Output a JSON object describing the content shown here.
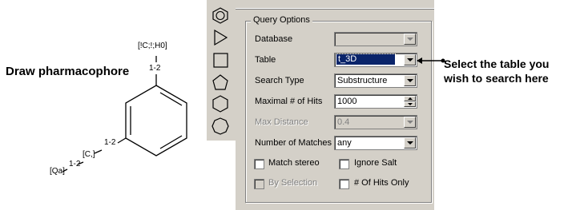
{
  "molecule": {
    "title": "Draw pharmacophore",
    "top_feature": "[!C;!;H0]",
    "top_range": "1-2",
    "mid_range": "1-2",
    "mid_atom": "[C,]",
    "bottom_range": "1-2",
    "bottom_feature": "[Qa]"
  },
  "tools": [
    "benzene-tool-icon",
    "triangle-tool-icon",
    "square-tool-icon",
    "pentagon-tool-icon",
    "hexagon-tool-icon",
    "heptagon-tool-icon"
  ],
  "query_options": {
    "legend": "Query Options",
    "database": {
      "label": "Database",
      "value": ""
    },
    "table": {
      "label": "Table",
      "value": "t_3D"
    },
    "search_type": {
      "label": "Search Type",
      "value": "Substructure"
    },
    "max_hits": {
      "label": "Maximal # of Hits",
      "value": "1000"
    },
    "max_distance": {
      "label": "Max Distance",
      "value": "0.4"
    },
    "num_matches": {
      "label": "Number of Matches",
      "value": "any"
    },
    "match_stereo": {
      "label": "Match stereo",
      "checked": false
    },
    "ignore_salt": {
      "label": "Ignore Salt",
      "checked": false
    },
    "by_selection": {
      "label": "By Selection",
      "checked": false
    },
    "hits_only": {
      "label": "# Of Hits Only",
      "checked": false
    }
  },
  "annotation": {
    "line1": "Select the table you",
    "line2": "wish to search here"
  }
}
